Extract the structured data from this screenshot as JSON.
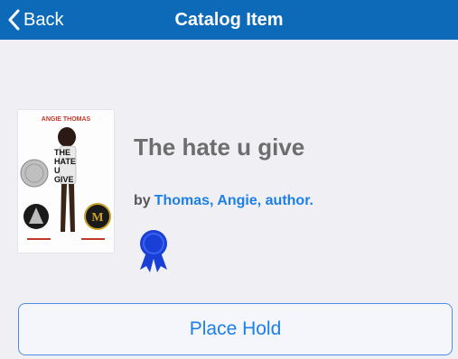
{
  "navbar": {
    "back_label": "Back",
    "title": "Catalog Item",
    "background": "#0d6ab8"
  },
  "item": {
    "cover": {
      "author_text": "ANGIE THOMAS",
      "title_lines": [
        "THE",
        "HATE",
        "U",
        "GIVE"
      ]
    },
    "title": "The hate u give",
    "by_prefix": "by",
    "author": "Thomas, Angie, author.",
    "award_icon": "award-ribbon-icon"
  },
  "actions": {
    "place_hold_label": "Place Hold"
  },
  "colors": {
    "link": "#1d7fe8",
    "title_text": "#6d6d6d",
    "page_background": "#efeff4"
  }
}
